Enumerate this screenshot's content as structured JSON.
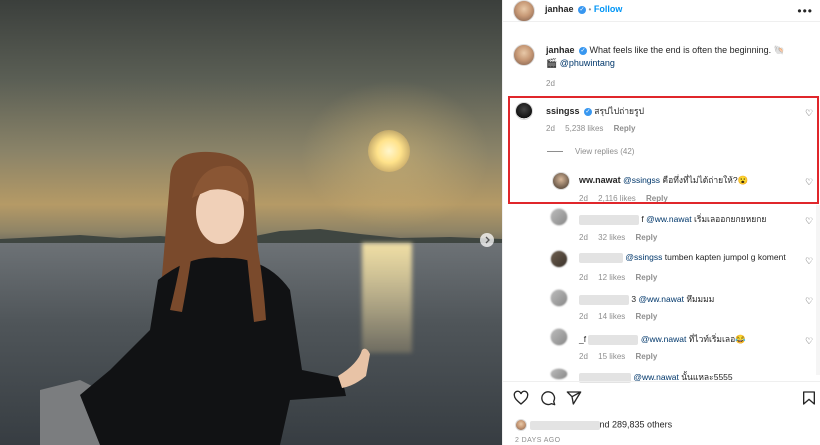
{
  "post_author": {
    "username": "janhae",
    "follow_label": "Follow",
    "dot": "•"
  },
  "caption": {
    "username": "janhae",
    "text": "What feels like the end is often the beginning. 🐚",
    "line2_icon": "🎬",
    "mention": "@phuwintang",
    "time": "2d"
  },
  "comments": [
    {
      "username": "ssingss",
      "verified": true,
      "text": "สรุปไปถ่ายรูป",
      "time": "2d",
      "likes": "5,238 likes",
      "reply": "Reply"
    },
    {
      "username": "ww.nawat",
      "mention": "@ssingss",
      "text": "คือทึ่งที่ไม่ได้ถ่ายให้?😮",
      "time": "2d",
      "likes": "2,116 likes",
      "reply": "Reply"
    },
    {
      "username_suffix": "f",
      "mention": "@ww.nawat",
      "text": "เริ่มเลออกยกยหยกย",
      "time": "2d",
      "likes": "32 likes",
      "reply": "Reply"
    },
    {
      "mention": "@ssingss",
      "text": "tumben kapten jumpol g koment",
      "time": "2d",
      "likes": "12 likes",
      "reply": "Reply"
    },
    {
      "username_suffix": "3",
      "mention": "@ww.nawat",
      "text": "หึมมมม",
      "time": "2d",
      "likes": "14 likes",
      "reply": "Reply"
    },
    {
      "username_prefix": "_f",
      "mention": "@ww.nawat",
      "text": "ที่ไวท์เริ่มเลอ😂",
      "time": "2d",
      "likes": "15 likes",
      "reply": "Reply"
    },
    {
      "mention": "@ww.nawat",
      "text": "นั้นแหละ5555"
    }
  ],
  "view_replies": "View replies (42)",
  "likes_summary": {
    "suffix": "nd 289,835 others"
  },
  "timestamp": "2 DAYS AGO",
  "icons": [
    "heart-icon",
    "comment-icon",
    "share-icon",
    "bookmark-icon",
    "verified-icon",
    "more-icon",
    "chevron-right-icon"
  ],
  "colors": {
    "accent": "#0095f6",
    "highlight_box": "#e0262b",
    "mention": "#00376b"
  }
}
